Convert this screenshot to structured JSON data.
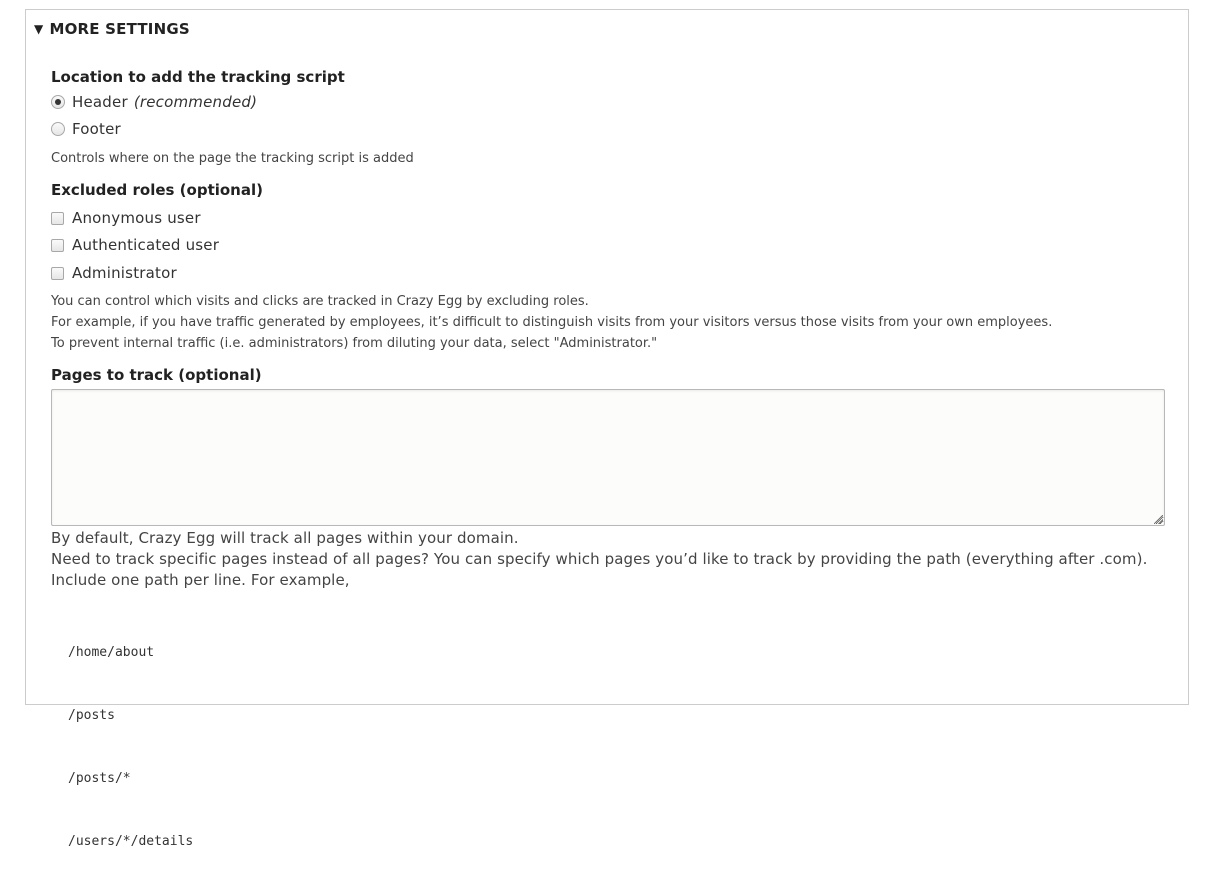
{
  "details": {
    "summary_label": "MORE SETTINGS",
    "toggle_glyph": "▼"
  },
  "location": {
    "label": "Location to add the tracking script",
    "options": [
      {
        "label": "Header",
        "suffix": "(recommended)",
        "checked": true
      },
      {
        "label": "Footer",
        "suffix": "",
        "checked": false
      }
    ],
    "description": "Controls where on the page the tracking script is added"
  },
  "excluded_roles": {
    "label": "Excluded roles (optional)",
    "options": [
      {
        "label": "Anonymous user",
        "checked": false
      },
      {
        "label": "Authenticated user",
        "checked": false
      },
      {
        "label": "Administrator",
        "checked": false
      }
    ],
    "description_lines": [
      "You can control which visits and clicks are tracked in Crazy Egg by excluding roles.",
      "For example, if you have traffic generated by employees, it’s difficult to distinguish visits from your visitors versus those visits from your own employees.",
      "To prevent internal traffic (i.e. administrators) from diluting your data, select \"Administrator.\""
    ]
  },
  "pages_to_track": {
    "label": "Pages to track (optional)",
    "value": "",
    "description_lines": [
      "By default, Crazy Egg will track all pages within your domain.",
      "Need to track specific pages instead of all pages? You can specify which pages you’d like to track by providing the path (everything after .com).",
      "Include one path per line. For example,"
    ],
    "examples": [
      "/home/about",
      "/posts",
      "/posts/*",
      "/users/*/details"
    ]
  }
}
